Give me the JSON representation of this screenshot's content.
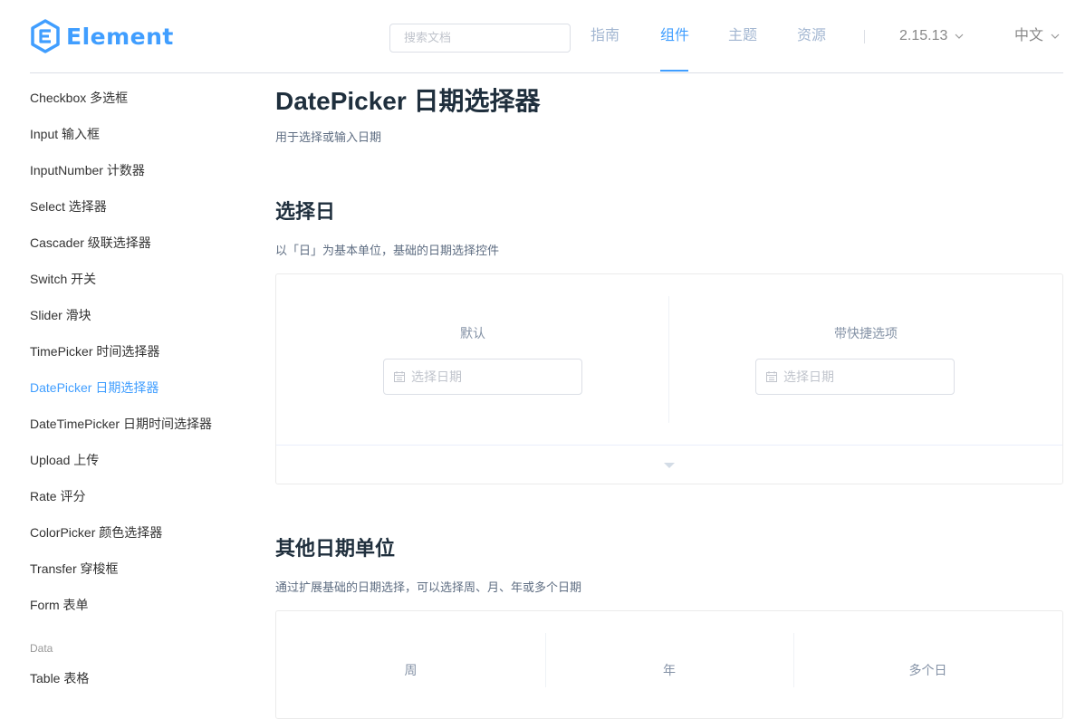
{
  "header": {
    "logo_text": "Element",
    "search_placeholder": "搜索文档",
    "nav": [
      "指南",
      "组件",
      "主题",
      "资源"
    ],
    "active_nav": "组件",
    "version": "2.15.13",
    "language": "中文",
    "accent_color": "#409eff"
  },
  "sidebar": {
    "items": [
      "Checkbox 多选框",
      "Input 输入框",
      "InputNumber 计数器",
      "Select 选择器",
      "Cascader 级联选择器",
      "Switch 开关",
      "Slider 滑块",
      "TimePicker 时间选择器",
      "DatePicker 日期选择器",
      "DateTimePicker 日期时间选择器",
      "Upload 上传",
      "Rate 评分",
      "ColorPicker 颜色选择器",
      "Transfer 穿梭框",
      "Form 表单"
    ],
    "active_item": "DatePicker 日期选择器",
    "group_label": "Data",
    "group_items": [
      "Table 表格"
    ]
  },
  "main": {
    "title": "DatePicker 日期选择器",
    "lead": "用于选择或输入日期",
    "sections": [
      {
        "heading": "选择日",
        "description": "以「日」为基本单位，基础的日期选择控件",
        "demos": [
          {
            "label": "默认",
            "placeholder": "选择日期"
          },
          {
            "label": "带快捷选项",
            "placeholder": "选择日期"
          }
        ]
      },
      {
        "heading": "其他日期单位",
        "description": "通过扩展基础的日期选择，可以选择周、月、年或多个日期",
        "demos": [
          {
            "label": "周"
          },
          {
            "label": "年"
          },
          {
            "label": "多个日"
          }
        ]
      }
    ]
  },
  "icons": {
    "logo": "element-logo-icon",
    "chevron": "chevron-down-icon",
    "calendar": "calendar-icon",
    "expand": "caret-down-icon"
  }
}
